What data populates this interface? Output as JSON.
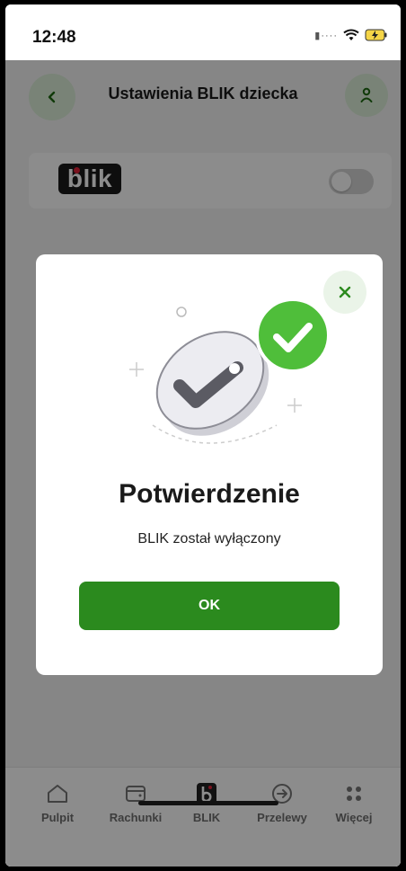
{
  "status_bar": {
    "time": "12:48"
  },
  "header": {
    "title": "Ustawienia BLIK dziecka"
  },
  "blik_row": {
    "logo_text": "blik",
    "toggle_on": false
  },
  "modal": {
    "title": "Potwierdzenie",
    "message": "BLIK został wyłączony",
    "ok_label": "OK"
  },
  "tabbar": {
    "items": [
      {
        "label": "Pulpit",
        "icon": "home-icon"
      },
      {
        "label": "Rachunki",
        "icon": "wallet-icon"
      },
      {
        "label": "BLIK",
        "icon": "blik-icon"
      },
      {
        "label": "Przelewy",
        "icon": "transfer-icon"
      },
      {
        "label": "Więcej",
        "icon": "more-icon"
      }
    ]
  },
  "colors": {
    "accent_green": "#2b8a1e",
    "light_green": "#dcefd9",
    "check_green": "#4fbe3a",
    "blik_red": "#e0233a"
  }
}
